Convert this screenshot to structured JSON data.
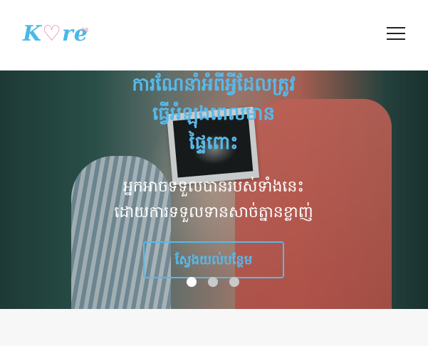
{
  "header": {
    "logo": {
      "k": "K",
      "heart": "♡",
      "rest": "re",
      "badge": "88"
    },
    "menu_icon": "hamburger-menu-icon"
  },
  "hero": {
    "title_lines": [
      "ការណែនាំអំពីអ្វីដែលត្រូវ",
      "ធ្វើអំឡុងពេលមាន",
      "ផ្ទៃពោះ"
    ],
    "subtitle_lines": [
      "អ្នកអាចទទួលបានរបស់ទាំងនេះ",
      "ដោយការទទួលទានសាច់ត្នានខ្លាញ់"
    ],
    "cta_label": "ស្វែងយល់បន្ថែម",
    "carousel": {
      "count": 3,
      "active": 0
    }
  },
  "colors": {
    "accent": "#57b9ea",
    "logo_pink": "#e98aa6",
    "header_bg": "#ffffff"
  }
}
